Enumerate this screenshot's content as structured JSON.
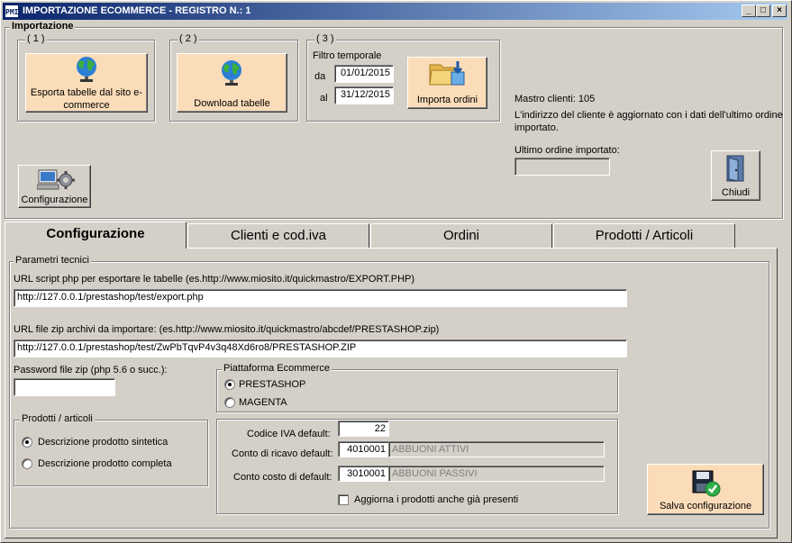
{
  "window": {
    "app_icon": "PMI",
    "title": "IMPORTAZIONE ECOMMERCE - REGISTRO N.: 1",
    "minimize": "_",
    "maximize": "□",
    "close": "×"
  },
  "importazione": {
    "title": "Importazione",
    "step1": {
      "label": "( 1 )",
      "button": "Esporta tabelle dal sito e-commerce"
    },
    "step2": {
      "label": "( 2 )",
      "button": "Download tabelle"
    },
    "step3": {
      "label": "( 3 )",
      "filter_label": "Filtro temporale",
      "from_label": "da",
      "from_value": "01/01/2015",
      "to_label": "al",
      "to_value": "31/12/2015",
      "button": "Importa ordini"
    },
    "configurazione_button": "Configurazione",
    "mastro_clienti": "Mastro clienti: 105",
    "info_text": "L'indirizzo del cliente è aggiornato con i dati dell'ultimo ordine importato.",
    "ultimo_ordine_label": "Ultimo ordine importato:",
    "ultimo_ordine_value": "",
    "chiudi_button": "Chiudi"
  },
  "tabs": [
    {
      "label": "Configurazione",
      "active": true
    },
    {
      "label": "Clienti e cod.iva",
      "active": false
    },
    {
      "label": "Ordini",
      "active": false
    },
    {
      "label": "Prodotti / Articoli",
      "active": false
    }
  ],
  "config": {
    "parametri_title": "Parametri tecnici",
    "url_script_label": "URL script php per esportare le tabelle (es.http://www.miosito.it/quickmastro/EXPORT.PHP)",
    "url_script_value": "http://127.0.0.1/prestashop/test/export.php",
    "url_zip_label": "URL file zip archivi da importare: (es.http://www.miosito.it/quickmastro/abcdef/PRESTASHOP.zip)",
    "url_zip_value": "http://127.0.0.1/prestashop/test/ZwPbTqvP4v3q48Xd6ro8/PRESTASHOP.ZIP",
    "password_label": "Password file zip (php 5.6 o succ.):",
    "password_value": "",
    "piattaforma_title": "Piattaforma Ecommerce",
    "piattaforma_options": [
      "PRESTASHOP",
      "MAGENTA"
    ],
    "piattaforma_selected": "PRESTASHOP",
    "prodotti_title": "Prodotti / articoli",
    "prodotti_options": [
      "Descrizione prodotto sintetica",
      "Descrizione prodotto completa"
    ],
    "prodotti_selected": "Descrizione prodotto sintetica",
    "codice_iva_label": "Codice IVA default:",
    "codice_iva_value": "22",
    "conto_ricavo_label": "Conto di ricavo default:",
    "conto_ricavo_code": "4010001",
    "conto_ricavo_desc": "ABBUONI ATTIVI",
    "conto_costo_label": "Conto costo di default:",
    "conto_costo_code": "3010001",
    "conto_costo_desc": "ABBUONI PASSIVI",
    "aggiorna_label": "Aggiorna i prodotti anche già presenti",
    "aggiorna_checked": false,
    "salva_button": "Salva configurazione"
  }
}
